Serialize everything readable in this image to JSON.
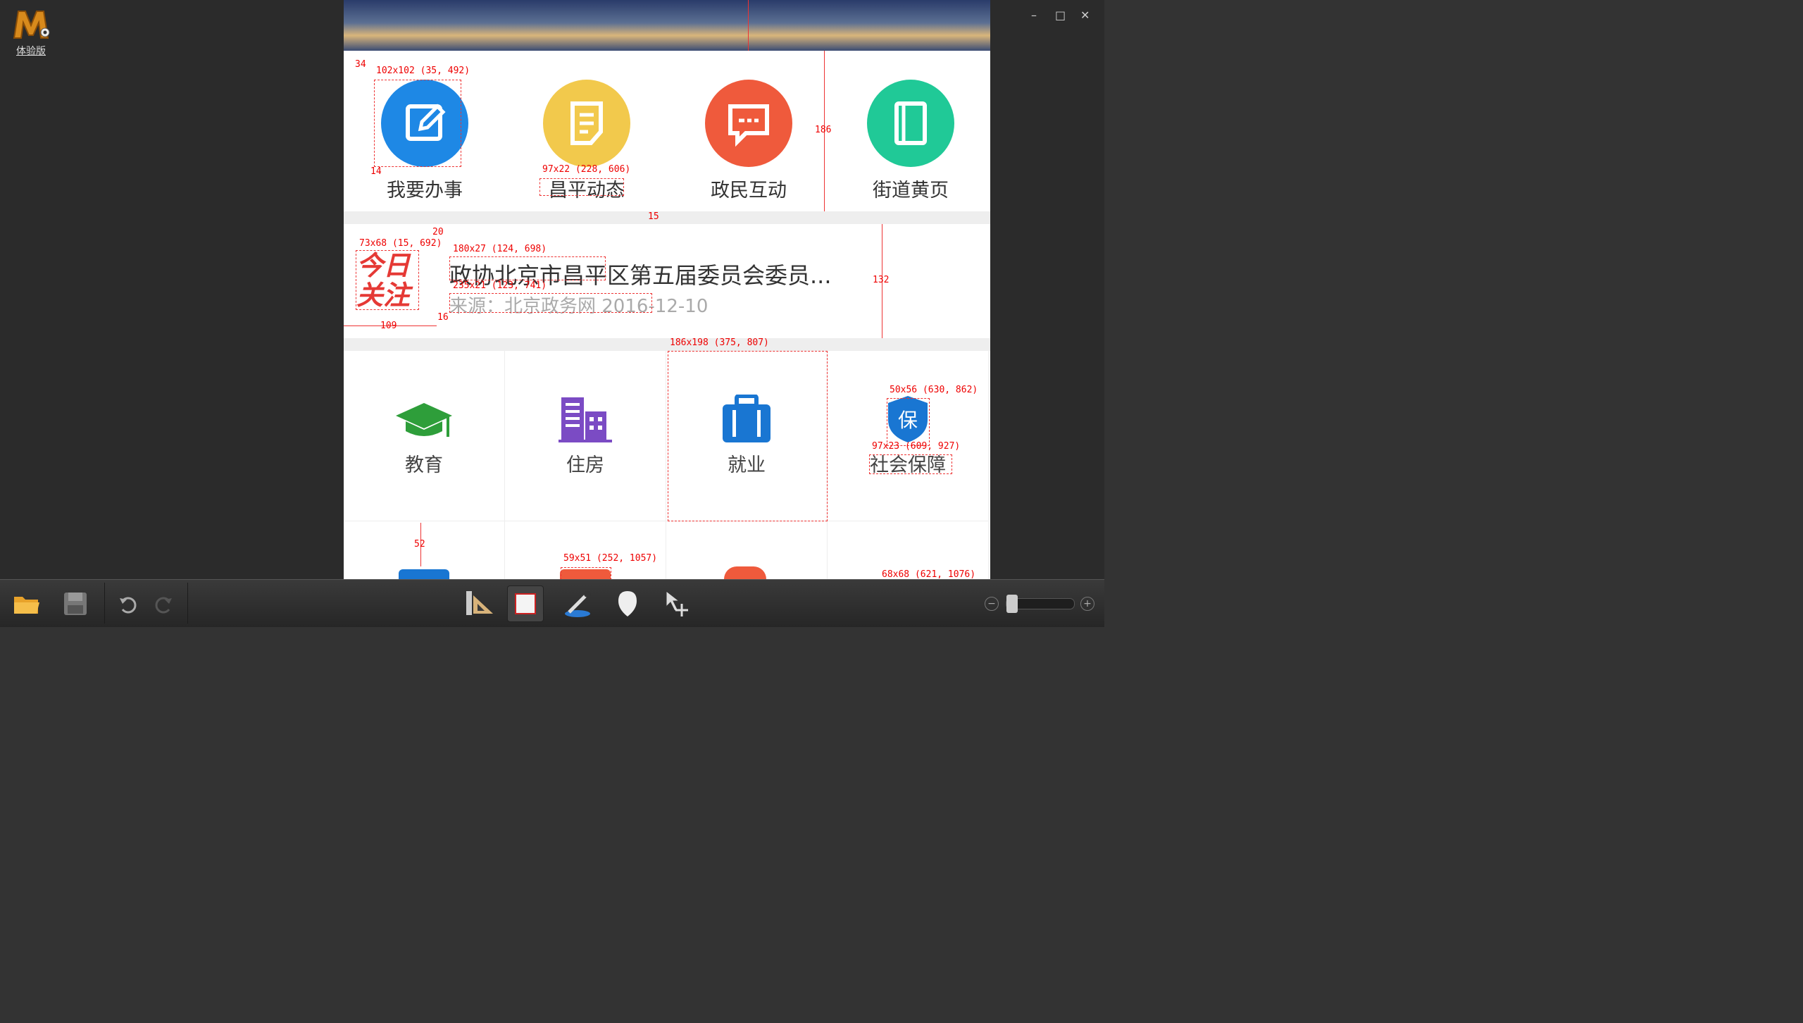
{
  "app": {
    "edition_label": "体验版"
  },
  "window_controls": {
    "minimize": "–",
    "maximize": "□",
    "close": "✕"
  },
  "tiles": [
    {
      "label": "我要办事",
      "color": "#1e88e5",
      "icon": "edit-icon"
    },
    {
      "label": "昌平动态",
      "color": "#f2c94c",
      "icon": "document-icon"
    },
    {
      "label": "政民互动",
      "color": "#ef5a3c",
      "icon": "chat-icon"
    },
    {
      "label": "街道黄页",
      "color": "#20c997",
      "icon": "book-icon"
    }
  ],
  "news": {
    "badge_line1": "今日",
    "badge_line2": "关注",
    "title": "政协北京市昌平区第五届委员会委员...",
    "meta": "来源：北京政务网   2016-12-10"
  },
  "services": [
    {
      "label": "教育",
      "icon": "graduation-cap-icon"
    },
    {
      "label": "住房",
      "icon": "building-icon"
    },
    {
      "label": "就业",
      "icon": "briefcase-icon"
    },
    {
      "label": "社会保障",
      "icon": "shield-icon",
      "icon_text": "保"
    }
  ],
  "measurements": [
    "34",
    "102x102 (35, 492)",
    "14",
    "97x22 (228, 606)",
    "186",
    "15",
    "20",
    "73x68 (15, 692)",
    "180x27 (124, 698)",
    "235x21 (123, 741)",
    "16",
    "109",
    "132",
    "186x198 (375, 807)",
    "50x56 (630, 862)",
    "97x23 (609, 927)",
    "52",
    "59x51 (252, 1057)",
    "68x68 (621, 1076)"
  ],
  "colors": {
    "accent_measure": "#e33",
    "toolbar_bg": "#2e2e2e"
  }
}
